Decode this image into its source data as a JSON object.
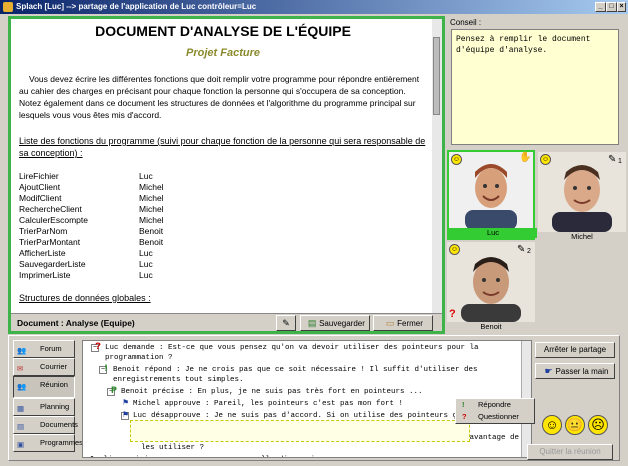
{
  "window": {
    "title": "Splach [Luc] --> partage de l'application de Luc contrôleur=Luc"
  },
  "document": {
    "title": "DOCUMENT D'ANALYSE DE L'ÉQUIPE",
    "subtitle": "Projet Facture",
    "intro": "Vous devez écrire les différentes fonctions que doit remplir votre programme pour répondre entièrement au cahier des charges en précisant pour chaque fonction la personne qui s'occupera de sa conception. Notez également dans ce document les structures de données et l'algorithme du programme principal sur lesquels vous vous êtes mis d'accord.",
    "list_heading": "Liste des fonctions du programme (suivi pour chaque fonction de la personne qui sera responsable de sa conception) :",
    "functions": [
      {
        "name": "LireFichier",
        "owner": "Luc"
      },
      {
        "name": "AjoutClient",
        "owner": "Michel"
      },
      {
        "name": "ModifClient",
        "owner": "Michel"
      },
      {
        "name": "RechercheClient",
        "owner": "Michel"
      },
      {
        "name": "CalculerEscompte",
        "owner": "Michel"
      },
      {
        "name": "TrierParNom",
        "owner": "Benoit"
      },
      {
        "name": "TrierParMontant",
        "owner": "Benoit"
      },
      {
        "name": "AfficherListe",
        "owner": "Luc"
      },
      {
        "name": "SauvegarderListe",
        "owner": "Luc"
      },
      {
        "name": "ImprimerListe",
        "owner": "Luc"
      }
    ],
    "structs_heading": "Structures de données globales :",
    "footer_title": "Document : Analyse (Equipe)",
    "save_label": "Sauvegarder",
    "close_label": "Fermer"
  },
  "conseil": {
    "label": "Conseil :",
    "text": "Pensez à remplir le document d'équipe d'analyse."
  },
  "participants": [
    {
      "name": "Luc",
      "hand": "",
      "highlight_color": "#33cc33"
    },
    {
      "name": "Michel",
      "hand": "1",
      "highlight_color": ""
    },
    {
      "name": "Benoit",
      "hand": "2",
      "highlight_color": ""
    }
  ],
  "nav": [
    {
      "label": "Forum",
      "icon": "forum-icon"
    },
    {
      "label": "Courrier",
      "icon": "mail-icon"
    },
    {
      "label": "Réunion",
      "icon": "meeting-icon"
    },
    {
      "label": "Planning",
      "icon": "calendar-icon"
    },
    {
      "label": "Documents",
      "icon": "documents-icon"
    },
    {
      "label": "Programmes",
      "icon": "programs-icon"
    }
  ],
  "discussion": {
    "messages": [
      "Luc demande : Est-ce que vous pensez qu'on va devoir utiliser des pointeurs pour la\nprogrammation ?",
      "Benoit répond : Je ne crois pas que ce soit nécessaire ! Il suffit d'utiliser des\nenregistrements tout simples.",
      "Benoit précise : En plus, je ne suis pas très fort en pointeurs ...",
      "Michel approuve : Pareil, les pointeurs c'est pas mon fort !",
      "Luc désapprouve : Je ne suis pas d'accord. Si on utilise des pointeurs ça va\nsimplifier la vie, surtout pour les tris.",
      "Michel questionne : J'ai vu les pointeurs dans le cours mais quels est l'avantage de\nles utiliser ?",
      "cliquer ici pour commencer une nouvelle discussion"
    ],
    "markers": [
      "?",
      "!",
      "P",
      "",
      "",
      "?",
      ""
    ]
  },
  "context_menu": {
    "reply": "Répondre",
    "question": "Questionner"
  },
  "actions": {
    "stop_sharing": "Arrêter le partage",
    "pass_hand": "Passer la main",
    "bottom_disabled": "Quitter la réunion"
  },
  "colors": {
    "active_border": "#3db34a",
    "conseil_bg": "#ffffd2",
    "title_bar": "#0a246a"
  }
}
